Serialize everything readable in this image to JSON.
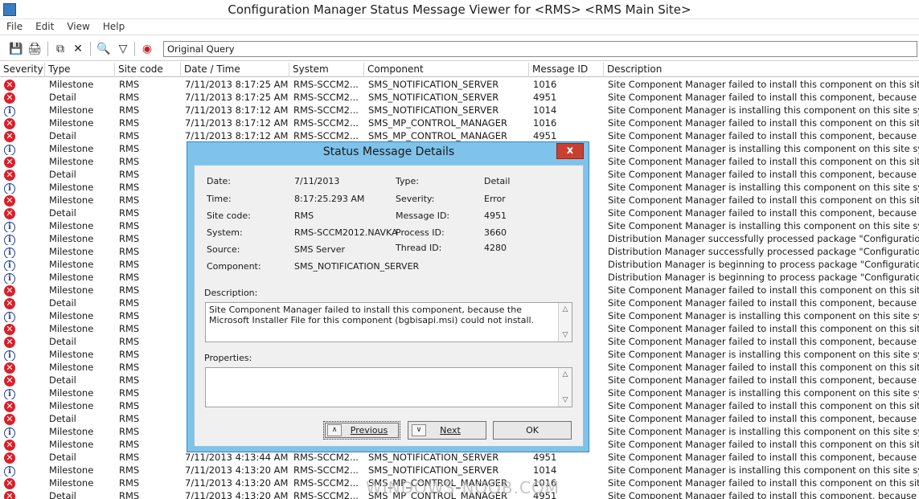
{
  "window": {
    "title": "Configuration Manager Status Message Viewer for <RMS> <RMS Main Site>"
  },
  "menu": [
    "File",
    "Edit",
    "View",
    "Help"
  ],
  "toolbar": {
    "query": "Original Query"
  },
  "columns": [
    "Severity",
    "Type",
    "Site code",
    "Date / Time",
    "System",
    "Component",
    "Message ID",
    "Description"
  ],
  "rows": [
    {
      "sev": "error",
      "type": "Milestone",
      "site": "RMS",
      "date": "7/11/2013 8:17:25 AM",
      "system": "RMS-SCCM2...",
      "comp": "SMS_NOTIFICATION_SERVER",
      "mid": "1016",
      "desc": "Site Component Manager failed to install this component on this site syst"
    },
    {
      "sev": "error",
      "type": "Detail",
      "site": "RMS",
      "date": "7/11/2013 8:17:25 AM",
      "system": "RMS-SCCM2...",
      "comp": "SMS_NOTIFICATION_SERVER",
      "mid": "4951",
      "desc": "Site Component Manager failed to install this component, because the M"
    },
    {
      "sev": "info",
      "type": "Milestone",
      "site": "RMS",
      "date": "7/11/2013 8:17:12 AM",
      "system": "RMS-SCCM2...",
      "comp": "SMS_NOTIFICATION_SERVER",
      "mid": "1014",
      "desc": "Site Component Manager is installing this component on this site system"
    },
    {
      "sev": "error",
      "type": "Milestone",
      "site": "RMS",
      "date": "7/11/2013 8:17:12 AM",
      "system": "RMS-SCCM2...",
      "comp": "SMS_MP_CONTROL_MANAGER",
      "mid": "1016",
      "desc": "Site Component Manager failed to install this component on this site syst"
    },
    {
      "sev": "error",
      "type": "Detail",
      "site": "RMS",
      "date": "7/11/2013 8:17:12 AM",
      "system": "RMS-SCCM2...",
      "comp": "SMS_MP_CONTROL_MANAGER",
      "mid": "4951",
      "desc": "Site Component Manager failed to install this component, because the M"
    },
    {
      "sev": "info",
      "type": "Milestone",
      "site": "RMS",
      "date": "",
      "system": "",
      "comp": "",
      "mid": "",
      "desc": "Site Component Manager is installing this component on this site system"
    },
    {
      "sev": "error",
      "type": "Milestone",
      "site": "RMS",
      "date": "",
      "system": "",
      "comp": "",
      "mid": "",
      "desc": "Site Component Manager failed to install this component on this site syst"
    },
    {
      "sev": "error",
      "type": "Detail",
      "site": "RMS",
      "date": "",
      "system": "",
      "comp": "",
      "mid": "",
      "desc": "Site Component Manager failed to install this component, because the M"
    },
    {
      "sev": "info",
      "type": "Milestone",
      "site": "RMS",
      "date": "",
      "system": "",
      "comp": "",
      "mid": "",
      "desc": "Site Component Manager is installing this component on this site system"
    },
    {
      "sev": "error",
      "type": "Milestone",
      "site": "RMS",
      "date": "",
      "system": "",
      "comp": "",
      "mid": "",
      "desc": "Site Component Manager failed to install this component on this site syst"
    },
    {
      "sev": "error",
      "type": "Detail",
      "site": "RMS",
      "date": "",
      "system": "",
      "comp": "",
      "mid": "",
      "desc": "Site Component Manager failed to install this component, because the M"
    },
    {
      "sev": "info",
      "type": "Milestone",
      "site": "RMS",
      "date": "",
      "system": "",
      "comp": "",
      "mid": "",
      "desc": "Site Component Manager is installing this component on this site system"
    },
    {
      "sev": "info",
      "type": "Milestone",
      "site": "RMS",
      "date": "",
      "system": "",
      "comp": "",
      "mid": "",
      "desc": "Distribution Manager successfully processed package \"Configuration Ma"
    },
    {
      "sev": "info",
      "type": "Milestone",
      "site": "RMS",
      "date": "",
      "system": "",
      "comp": "",
      "mid": "",
      "desc": "Distribution Manager successfully processed package \"Configuration Ma"
    },
    {
      "sev": "info",
      "type": "Milestone",
      "site": "RMS",
      "date": "",
      "system": "",
      "comp": "",
      "mid": "",
      "desc": "Distribution Manager is beginning to process package \"Configuration Ma"
    },
    {
      "sev": "info",
      "type": "Milestone",
      "site": "RMS",
      "date": "",
      "system": "",
      "comp": "",
      "mid": "",
      "desc": "Distribution Manager is beginning to process package \"Configuration Ma"
    },
    {
      "sev": "error",
      "type": "Milestone",
      "site": "RMS",
      "date": "",
      "system": "",
      "comp": "",
      "mid": "",
      "desc": "Site Component Manager failed to install this component on this site syst"
    },
    {
      "sev": "error",
      "type": "Detail",
      "site": "RMS",
      "date": "",
      "system": "",
      "comp": "",
      "mid": "",
      "desc": "Site Component Manager failed to install this component, because the M"
    },
    {
      "sev": "info",
      "type": "Milestone",
      "site": "RMS",
      "date": "",
      "system": "",
      "comp": "",
      "mid": "",
      "desc": "Site Component Manager is installing this component on this site system"
    },
    {
      "sev": "error",
      "type": "Milestone",
      "site": "RMS",
      "date": "",
      "system": "",
      "comp": "",
      "mid": "",
      "desc": "Site Component Manager failed to install this component on this site syst"
    },
    {
      "sev": "error",
      "type": "Detail",
      "site": "RMS",
      "date": "",
      "system": "",
      "comp": "",
      "mid": "",
      "desc": "Site Component Manager failed to install this component, because the M"
    },
    {
      "sev": "info",
      "type": "Milestone",
      "site": "RMS",
      "date": "",
      "system": "",
      "comp": "",
      "mid": "",
      "desc": "Site Component Manager is installing this component on this site system"
    },
    {
      "sev": "error",
      "type": "Milestone",
      "site": "RMS",
      "date": "",
      "system": "",
      "comp": "",
      "mid": "",
      "desc": "Site Component Manager failed to install this component on this site syst"
    },
    {
      "sev": "error",
      "type": "Detail",
      "site": "RMS",
      "date": "",
      "system": "",
      "comp": "",
      "mid": "",
      "desc": "Site Component Manager failed to install this component, because the M"
    },
    {
      "sev": "info",
      "type": "Milestone",
      "site": "RMS",
      "date": "",
      "system": "",
      "comp": "",
      "mid": "",
      "desc": "Site Component Manager is installing this component on this site system"
    },
    {
      "sev": "error",
      "type": "Milestone",
      "site": "RMS",
      "date": "",
      "system": "",
      "comp": "",
      "mid": "",
      "desc": "Site Component Manager failed to install this component on this site syst"
    },
    {
      "sev": "error",
      "type": "Detail",
      "site": "RMS",
      "date": "",
      "system": "",
      "comp": "",
      "mid": "",
      "desc": "Site Component Manager failed to install this component, because the M"
    },
    {
      "sev": "info",
      "type": "Milestone",
      "site": "RMS",
      "date": "",
      "system": "",
      "comp": "",
      "mid": "",
      "desc": "Site Component Manager is installing this component on this site system"
    },
    {
      "sev": "error",
      "type": "Milestone",
      "site": "RMS",
      "date": "",
      "system": "",
      "comp": "",
      "mid": "",
      "desc": "Site Component Manager failed to install this component on this site syst"
    },
    {
      "sev": "error",
      "type": "Detail",
      "site": "RMS",
      "date": "7/11/2013 4:13:44 AM",
      "system": "RMS-SCCM2...",
      "comp": "SMS_NOTIFICATION_SERVER",
      "mid": "4951",
      "desc": "Site Component Manager failed to install this component, because the M"
    },
    {
      "sev": "info",
      "type": "Milestone",
      "site": "RMS",
      "date": "7/11/2013 4:13:20 AM",
      "system": "RMS-SCCM2...",
      "comp": "SMS_NOTIFICATION_SERVER",
      "mid": "1014",
      "desc": "Site Component Manager is installing this component on this site system"
    },
    {
      "sev": "error",
      "type": "Milestone",
      "site": "RMS",
      "date": "7/11/2013 4:13:20 AM",
      "system": "RMS-SCCM2...",
      "comp": "SMS_MP_CONTROL_MANAGER",
      "mid": "1016",
      "desc": "Site Component Manager failed to install this component on this site syst"
    },
    {
      "sev": "error",
      "type": "Detail",
      "site": "RMS",
      "date": "7/11/2013 4:13:20 AM",
      "system": "RMS-SCCM2...",
      "comp": "SMS_MP_CONTROL_MANAGER",
      "mid": "4951",
      "desc": "Site Component Manager failed to install this component, because the M"
    }
  ],
  "dialog": {
    "title": "Status Message Details",
    "close": "x",
    "labels": {
      "date": "Date:",
      "time": "Time:",
      "site_code": "Site code:",
      "system": "System:",
      "source": "Source:",
      "component": "Component:",
      "type": "Type:",
      "severity": "Severity:",
      "message_id": "Message ID:",
      "process_id": "Process ID:",
      "thread_id": "Thread ID:",
      "description": "Description:",
      "properties": "Properties:"
    },
    "values": {
      "date": "7/11/2013",
      "time": "8:17:25.293 AM",
      "site_code": "RMS",
      "system": "RMS-SCCM2012.NAVKA",
      "source": "SMS Server",
      "component": "SMS_NOTIFICATION_SERVER",
      "type": "Detail",
      "severity": "Error",
      "message_id": "4951",
      "process_id": "3660",
      "thread_id": "4280"
    },
    "description_text": "Site Component Manager failed to install this component, because the Microsoft Installer File for this component (bgbisapi.msi) could not install.",
    "properties_text": "",
    "buttons": {
      "previous": "Previous",
      "next": "Next",
      "ok": "OK"
    }
  },
  "watermark": "WINDOWS-NOOB.COM",
  "colors": {
    "error": "#d9202a",
    "info": "#1f3f8f",
    "dialog_frame": "#7fc2ea",
    "close_button": "#c84031"
  }
}
